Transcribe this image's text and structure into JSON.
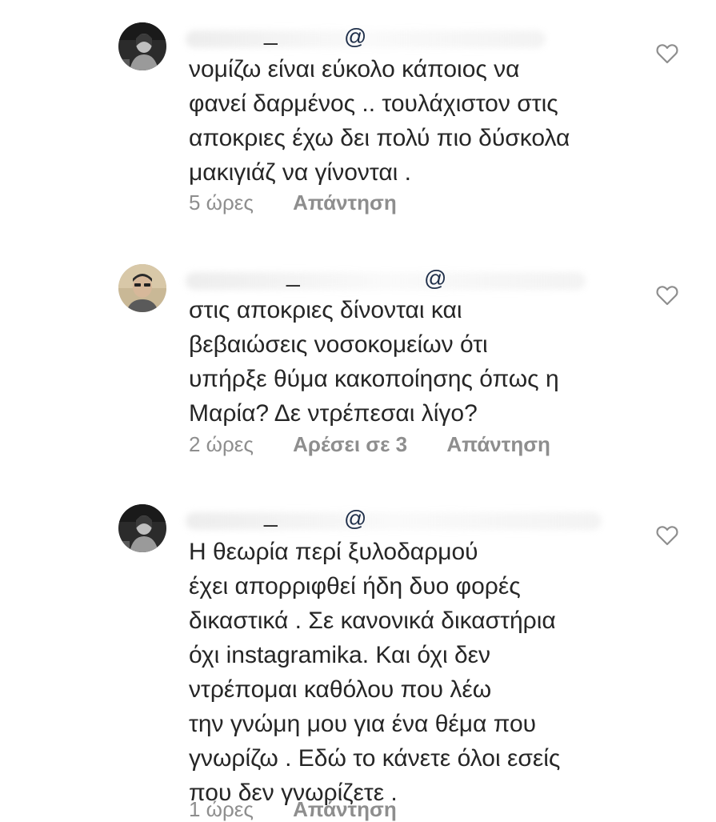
{
  "comments": [
    {
      "username_separator": "_",
      "at_symbol": "@",
      "text": "νομίζω είναι εύκολο κάποιος να\nφανεί δαρμένος .. τουλάχιστον στις\nαποκριες έχω δει πολύ πιο δύσκολα\nμακιγιάζ να γίνονται .",
      "time": "5 ώρες",
      "likes": "",
      "reply": "Απάντηση",
      "like_icon": "heart-outline-icon"
    },
    {
      "username_separator": "_",
      "at_symbol": "@",
      "text": "στις αποκριες δίνονται και\nβεβαιώσεις νοσοκομείων ότι\nυπήρξε θύμα κακοποίησης όπως η\nΜαρία? Δε ντρέπεσαι λίγο?",
      "time": "2 ώρες",
      "likes": "Αρέσει σε 3",
      "reply": "Απάντηση",
      "like_icon": "heart-outline-icon"
    },
    {
      "username_separator": "_",
      "at_symbol": "@",
      "text": "Η θεωρία περί ξυλοδαρμού\nέχει απορριφθεί ήδη δυο φορές\nδικαστικά . Σε κανονικά δικαστήρια\nόχι instagramika. Και όχι δεν\nντρέπομαι καθόλου που λέω\nτην γνώμη μου για ένα θέμα που\nγνωρίζω . Εδώ το κάνετε όλοι εσείς\nπου δεν γνωρίζετε .",
      "time": "1 ώρες",
      "likes": "",
      "reply": "Απάντηση",
      "like_icon": "heart-outline-icon"
    }
  ],
  "colors": {
    "text": "#262626",
    "meta": "#8e8e8e",
    "background": "#ffffff"
  }
}
